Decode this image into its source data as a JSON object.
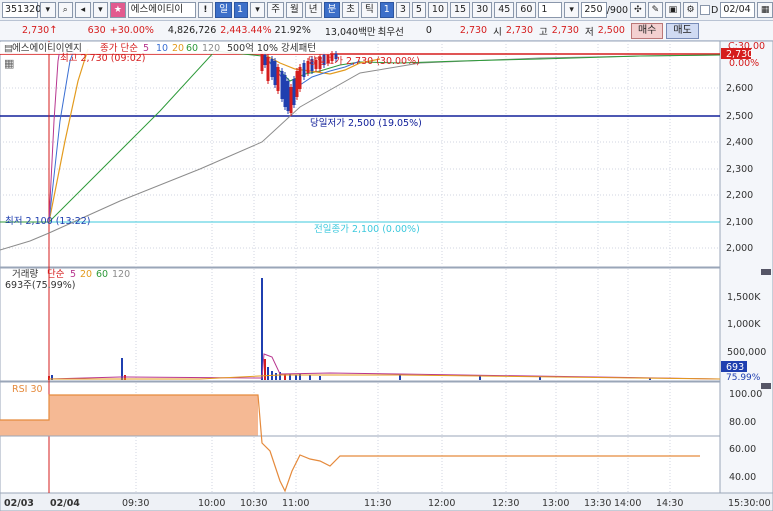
{
  "toolbar": {
    "code": "351320",
    "name": "에스에이티이",
    "period_unit_value": "1",
    "periods": [
      "주",
      "월",
      "년",
      "분",
      "초",
      "틱"
    ],
    "minutes": [
      "1",
      "3",
      "5",
      "10",
      "15",
      "30",
      "45",
      "60"
    ],
    "interval": "1",
    "count": "250",
    "count_total": "/900",
    "date": "02/04",
    "date_checkbox_label": "D"
  },
  "info": {
    "price": "2,730",
    "change": "630",
    "change_pct": "+30.00%",
    "volume": "4,826,726",
    "volume_pct": "2,443.44%",
    "turnover_pct": "21.92%",
    "amount": "13,040백만",
    "best_label": "최우선",
    "best_value": "0",
    "best_price": "2,730",
    "open_label": "시",
    "open": "2,730",
    "high_label": "고",
    "high": "2,730",
    "low_label": "저",
    "low": "2,500",
    "buy": "매수",
    "sell": "매도"
  },
  "legend": {
    "stock": "에스에이티이엔지",
    "ma_title": "종가 단순",
    "ma5": "5",
    "ma10": "10",
    "ma20": "20",
    "ma60": "60",
    "ma120": "120",
    "extra": "500억 10% 강세패턴"
  },
  "annotations": {
    "high": "최고 2,730 (09:02)",
    "low": "최저 2,100 (13:22)",
    "today_high": "당일고가 2,730 (30.00%)",
    "today_low": "당일저가 2,500 (19.05%)",
    "prev_close": "전일종가 2,100 (0.00%)"
  },
  "price_axis": {
    "ticks": [
      "2,600",
      "2,500",
      "2,400",
      "2,300",
      "2,200",
      "2,100",
      "2,000"
    ],
    "top_label": "C:30.00",
    "current": "2,730",
    "current_pct": "0.00%"
  },
  "volume_panel": {
    "title": "거래량",
    "ma_title": "단순",
    "ma5": "5",
    "ma20": "20",
    "ma60": "60",
    "ma120": "120",
    "value_label": "693주(75.99%)",
    "ticks": [
      "1,500K",
      "1,000K",
      "500,000"
    ],
    "current": "693",
    "current_pct": "75.99%"
  },
  "rsi_panel": {
    "title": "RSI 30",
    "ticks": [
      "100.00",
      "80.00",
      "60.00",
      "40.00"
    ]
  },
  "time_axis": {
    "labels": [
      "02/03",
      "02/04",
      "09:30",
      "10:00",
      "10:30",
      "11:00",
      "11:30",
      "12:00",
      "12:30",
      "13:00",
      "13:30",
      "14:00",
      "14:30",
      "15:30:00"
    ]
  },
  "colors": {
    "up": "#d51d1d",
    "down": "#1f3fb0",
    "ma5": "#b8368f",
    "ma10": "#3a6fd3",
    "ma20": "#e39b1e",
    "ma60": "#2e9a3a",
    "ma120": "#8c8c8c",
    "rsi_fill": "#f5b994",
    "rsi_line": "#e58a3c",
    "prev_close_line": "#3ec9dd",
    "low_line": "#12209a"
  }
}
